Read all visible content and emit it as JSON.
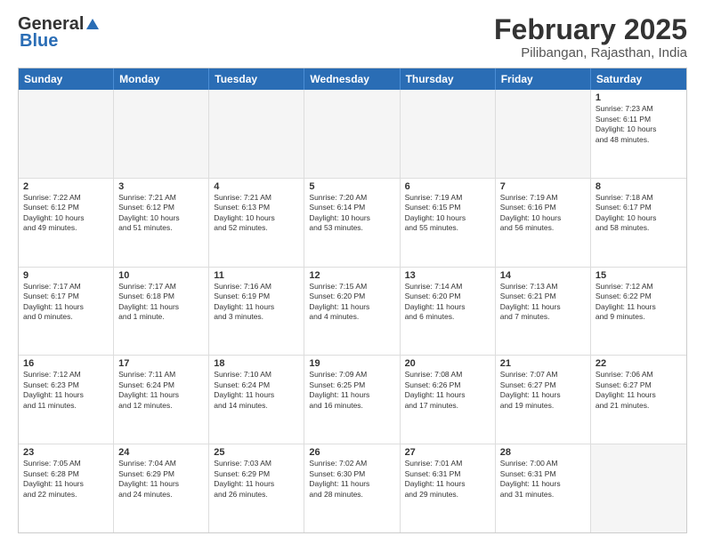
{
  "header": {
    "logo_general": "General",
    "logo_blue": "Blue",
    "title": "February 2025",
    "subtitle": "Pilibangan, Rajasthan, India"
  },
  "weekdays": [
    "Sunday",
    "Monday",
    "Tuesday",
    "Wednesday",
    "Thursday",
    "Friday",
    "Saturday"
  ],
  "rows": [
    [
      {
        "day": "",
        "info": ""
      },
      {
        "day": "",
        "info": ""
      },
      {
        "day": "",
        "info": ""
      },
      {
        "day": "",
        "info": ""
      },
      {
        "day": "",
        "info": ""
      },
      {
        "day": "",
        "info": ""
      },
      {
        "day": "1",
        "info": "Sunrise: 7:23 AM\nSunset: 6:11 PM\nDaylight: 10 hours\nand 48 minutes."
      }
    ],
    [
      {
        "day": "2",
        "info": "Sunrise: 7:22 AM\nSunset: 6:12 PM\nDaylight: 10 hours\nand 49 minutes."
      },
      {
        "day": "3",
        "info": "Sunrise: 7:21 AM\nSunset: 6:12 PM\nDaylight: 10 hours\nand 51 minutes."
      },
      {
        "day": "4",
        "info": "Sunrise: 7:21 AM\nSunset: 6:13 PM\nDaylight: 10 hours\nand 52 minutes."
      },
      {
        "day": "5",
        "info": "Sunrise: 7:20 AM\nSunset: 6:14 PM\nDaylight: 10 hours\nand 53 minutes."
      },
      {
        "day": "6",
        "info": "Sunrise: 7:19 AM\nSunset: 6:15 PM\nDaylight: 10 hours\nand 55 minutes."
      },
      {
        "day": "7",
        "info": "Sunrise: 7:19 AM\nSunset: 6:16 PM\nDaylight: 10 hours\nand 56 minutes."
      },
      {
        "day": "8",
        "info": "Sunrise: 7:18 AM\nSunset: 6:17 PM\nDaylight: 10 hours\nand 58 minutes."
      }
    ],
    [
      {
        "day": "9",
        "info": "Sunrise: 7:17 AM\nSunset: 6:17 PM\nDaylight: 11 hours\nand 0 minutes."
      },
      {
        "day": "10",
        "info": "Sunrise: 7:17 AM\nSunset: 6:18 PM\nDaylight: 11 hours\nand 1 minute."
      },
      {
        "day": "11",
        "info": "Sunrise: 7:16 AM\nSunset: 6:19 PM\nDaylight: 11 hours\nand 3 minutes."
      },
      {
        "day": "12",
        "info": "Sunrise: 7:15 AM\nSunset: 6:20 PM\nDaylight: 11 hours\nand 4 minutes."
      },
      {
        "day": "13",
        "info": "Sunrise: 7:14 AM\nSunset: 6:20 PM\nDaylight: 11 hours\nand 6 minutes."
      },
      {
        "day": "14",
        "info": "Sunrise: 7:13 AM\nSunset: 6:21 PM\nDaylight: 11 hours\nand 7 minutes."
      },
      {
        "day": "15",
        "info": "Sunrise: 7:12 AM\nSunset: 6:22 PM\nDaylight: 11 hours\nand 9 minutes."
      }
    ],
    [
      {
        "day": "16",
        "info": "Sunrise: 7:12 AM\nSunset: 6:23 PM\nDaylight: 11 hours\nand 11 minutes."
      },
      {
        "day": "17",
        "info": "Sunrise: 7:11 AM\nSunset: 6:24 PM\nDaylight: 11 hours\nand 12 minutes."
      },
      {
        "day": "18",
        "info": "Sunrise: 7:10 AM\nSunset: 6:24 PM\nDaylight: 11 hours\nand 14 minutes."
      },
      {
        "day": "19",
        "info": "Sunrise: 7:09 AM\nSunset: 6:25 PM\nDaylight: 11 hours\nand 16 minutes."
      },
      {
        "day": "20",
        "info": "Sunrise: 7:08 AM\nSunset: 6:26 PM\nDaylight: 11 hours\nand 17 minutes."
      },
      {
        "day": "21",
        "info": "Sunrise: 7:07 AM\nSunset: 6:27 PM\nDaylight: 11 hours\nand 19 minutes."
      },
      {
        "day": "22",
        "info": "Sunrise: 7:06 AM\nSunset: 6:27 PM\nDaylight: 11 hours\nand 21 minutes."
      }
    ],
    [
      {
        "day": "23",
        "info": "Sunrise: 7:05 AM\nSunset: 6:28 PM\nDaylight: 11 hours\nand 22 minutes."
      },
      {
        "day": "24",
        "info": "Sunrise: 7:04 AM\nSunset: 6:29 PM\nDaylight: 11 hours\nand 24 minutes."
      },
      {
        "day": "25",
        "info": "Sunrise: 7:03 AM\nSunset: 6:29 PM\nDaylight: 11 hours\nand 26 minutes."
      },
      {
        "day": "26",
        "info": "Sunrise: 7:02 AM\nSunset: 6:30 PM\nDaylight: 11 hours\nand 28 minutes."
      },
      {
        "day": "27",
        "info": "Sunrise: 7:01 AM\nSunset: 6:31 PM\nDaylight: 11 hours\nand 29 minutes."
      },
      {
        "day": "28",
        "info": "Sunrise: 7:00 AM\nSunset: 6:31 PM\nDaylight: 11 hours\nand 31 minutes."
      },
      {
        "day": "",
        "info": ""
      }
    ]
  ]
}
